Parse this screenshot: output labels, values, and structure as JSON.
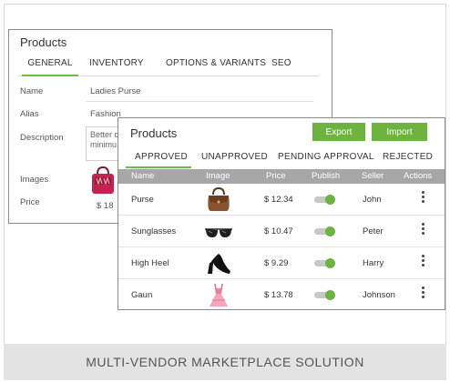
{
  "back_card": {
    "title": "Products",
    "tabs": [
      "GENERAL",
      "INVENTORY",
      "OPTIONS & VARIANTS",
      "SEO"
    ],
    "form": {
      "name_label": "Name",
      "name_value": "Ladies Purse",
      "alias_label": "Alias",
      "alias_value": "Fashion",
      "description_label": "Description",
      "description_value": "Better c... minimu...",
      "images_label": "Images",
      "price_label": "Price",
      "price_value": "$ 18"
    }
  },
  "front_card": {
    "title": "Products",
    "export_label": "Export",
    "import_label": "Import",
    "tabs": [
      "APPROVED",
      "UNAPPROVED",
      "PENDING APPROVAL",
      "REJECTED"
    ],
    "columns": [
      "Name",
      "Image",
      "Price",
      "Publish",
      "Seller",
      "Actions"
    ],
    "rows": [
      {
        "name": "Purse",
        "image": "purse",
        "price": "$ 12.34",
        "seller": "John"
      },
      {
        "name": "Sunglasses",
        "image": "sunglasses",
        "price": "$ 10.47",
        "seller": "Peter"
      },
      {
        "name": "High Heel",
        "image": "high-heel",
        "price": "$ 9.29",
        "seller": "Harry"
      },
      {
        "name": "Gaun",
        "image": "gown",
        "price": "$ 13.78",
        "seller": "Johnson"
      }
    ]
  },
  "footer": {
    "text": "MULTI-VENDOR MARKETPLACE SOLUTION"
  },
  "colors": {
    "accent": "#6db33f",
    "header_gray": "#a7a7a7"
  }
}
